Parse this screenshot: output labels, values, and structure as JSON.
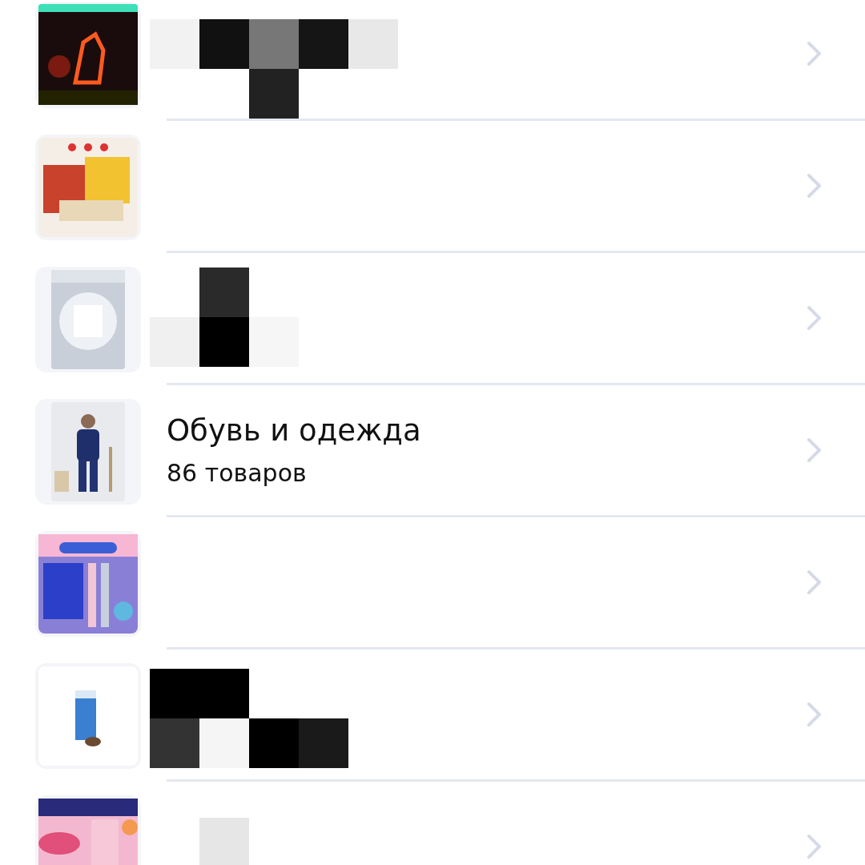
{
  "categories": [
    {
      "kind": "redacted"
    },
    {
      "kind": "redacted"
    },
    {
      "kind": "redacted"
    },
    {
      "kind": "category",
      "title": "Обувь и одежда",
      "count": "86 товаров"
    },
    {
      "kind": "redacted"
    },
    {
      "kind": "redacted"
    },
    {
      "kind": "redacted"
    }
  ]
}
